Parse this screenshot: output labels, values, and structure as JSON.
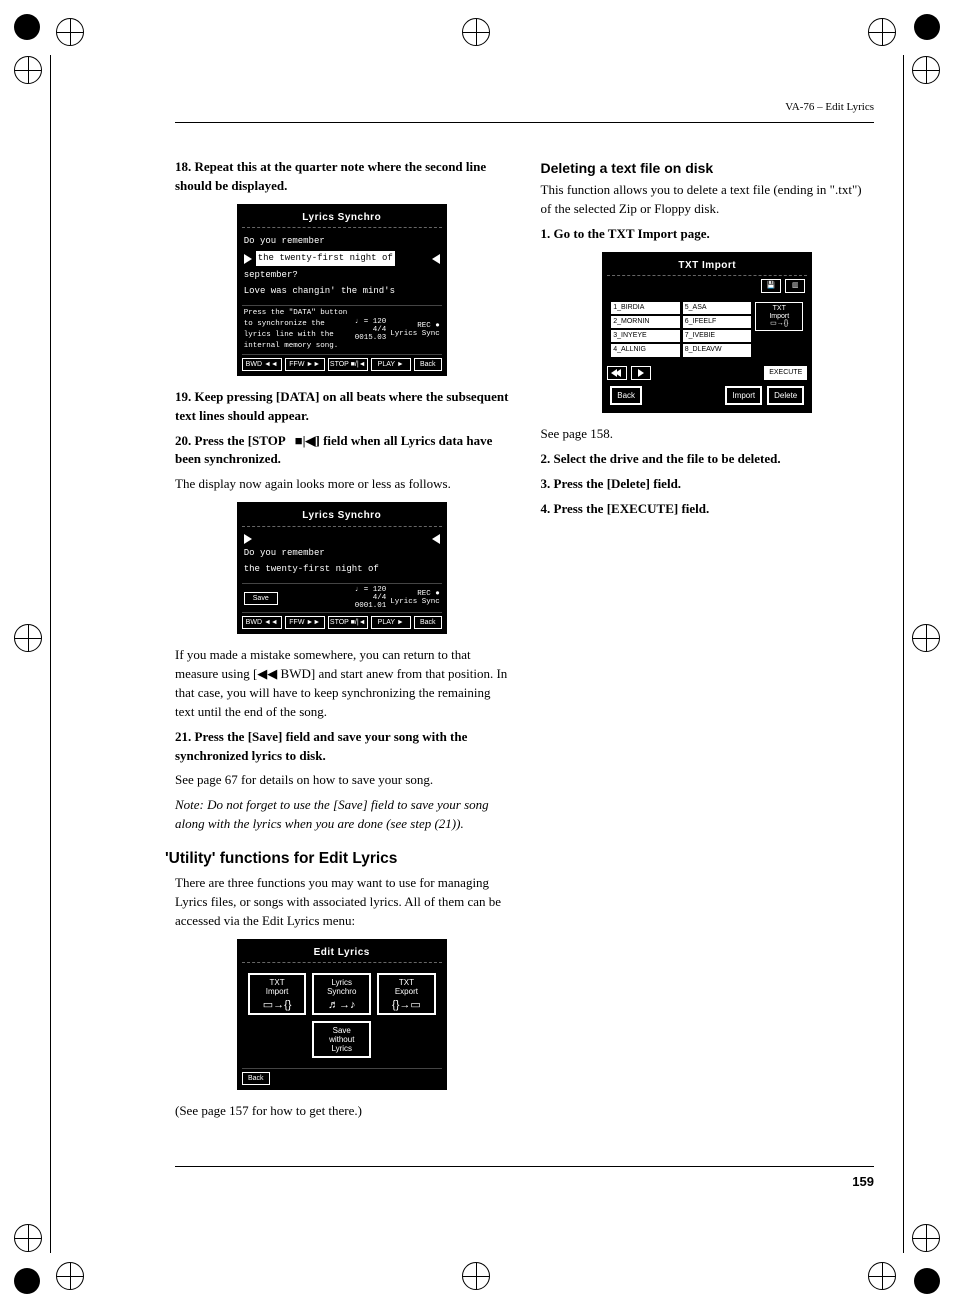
{
  "header": {
    "doc_title": "VA-76 – Edit Lyrics"
  },
  "page_number": "159",
  "left": {
    "step18": {
      "num": "18.",
      "text": "Repeat this at the quarter note where the second line should be displayed."
    },
    "lcd1": {
      "title": "Lyrics Synchro",
      "l1": "Do you remember",
      "l2": "the twenty-first night of",
      "l3": "september?",
      "l4": "Love was changin' the mind's",
      "help": "Press the \"DATA\" button to synchronize the lyrics line with the internal memory song.",
      "tempo": "♩ = 120",
      "sig": "4/4",
      "pos": "0015.03",
      "rec": "REC ●",
      "ls": "Lyrics Sync",
      "b_bwd": "BWD\n◄◄",
      "b_ffw": "FFW\n►►",
      "b_stop": "STOP\n■/|◄",
      "b_play": "PLAY\n►",
      "b_back": "Back"
    },
    "step19": {
      "num": "19.",
      "text_a": "Keep pressing [DATA]",
      "text_b": " on all beats where the subsequent text lines should appear."
    },
    "step20": {
      "num": "20.",
      "text_a": "Press the [STOP   ■|◀] field when all Lyrics data have been synchronized."
    },
    "after20": "The display now again looks more or less as follows.",
    "lcd2": {
      "title": "Lyrics Synchro",
      "l1": "Do you remember",
      "l2": "the twenty-first night of",
      "tempo": "♩ = 120",
      "sig": "4/4",
      "pos": "0001.01",
      "rec": "REC ●",
      "ls": "Lyrics Sync",
      "b_save": "Save",
      "b_bwd": "BWD\n◄◄",
      "b_ffw": "FFW\n►►",
      "b_stop": "STOP\n■/|◄",
      "b_play": "PLAY\n►",
      "b_back": "Back"
    },
    "mistake": "If you made a mistake somewhere, you can return to that measure using [◀◀ BWD] and start anew from that position. In that case, you will have to keep synchronizing the remaining text until the end of the song.",
    "step21": {
      "num": "21.",
      "text": "Press the [Save] field and save your song with the synchronized lyrics to disk."
    },
    "see67": "See page 67 for details on how to save your song.",
    "note": "Note: Do not forget to use the [Save] field to save your song along with the lyrics when you are done (see step (21)).",
    "h_utility": "'Utility' functions for Edit Lyrics",
    "utility_intro": "There are three functions you may want to use for managing Lyrics files, or songs with associated lyrics. All of them can be accessed via the Edit Lyrics menu:",
    "lcd3": {
      "title": "Edit Lyrics",
      "t1_a": "TXT",
      "t1_b": "Import",
      "t1_g": "▭→{}",
      "t2_a": "Lyrics",
      "t2_b": "Synchro",
      "t2_g": "♬→♪",
      "t3_a": "TXT",
      "t3_b": "Export",
      "t3_g": "{}→▭",
      "t4_a": "Save",
      "t4_b": "without",
      "t4_c": "Lyrics",
      "b_back": "Back"
    },
    "see157": "(See page 157 for how to get there.)"
  },
  "right": {
    "h_delete": "Deleting a text file on disk",
    "intro": "This function allows you to delete a text file (ending in \".txt\") of the selected Zip or Floppy disk.",
    "s1": {
      "num": "1.",
      "text": "Go to the TXT Import page."
    },
    "lcd": {
      "title": "TXT Import",
      "c1": "1_BIRDIA",
      "c5": "5_ASA",
      "c2": "2_MORNIN",
      "c6": "6_IFEELF",
      "c3": "3_INYEYE",
      "c7": "7_IVEBIE",
      "c4": "4_ALLNIG",
      "c8": "8_DLEAVW",
      "side_a": "TXT",
      "side_b": "Import",
      "side_g": "▭→{}",
      "exec": "EXECUTE",
      "bot_back": "Back",
      "bot_import": "Import",
      "bot_delete": "Delete"
    },
    "see158": "See page 158.",
    "s2": {
      "num": "2.",
      "text": "Select the drive and the file to be deleted."
    },
    "s3": {
      "num": "3.",
      "text": "Press the [Delete] field."
    },
    "s4": {
      "num": "4.",
      "text": "Press the [EXECUTE] field."
    }
  }
}
